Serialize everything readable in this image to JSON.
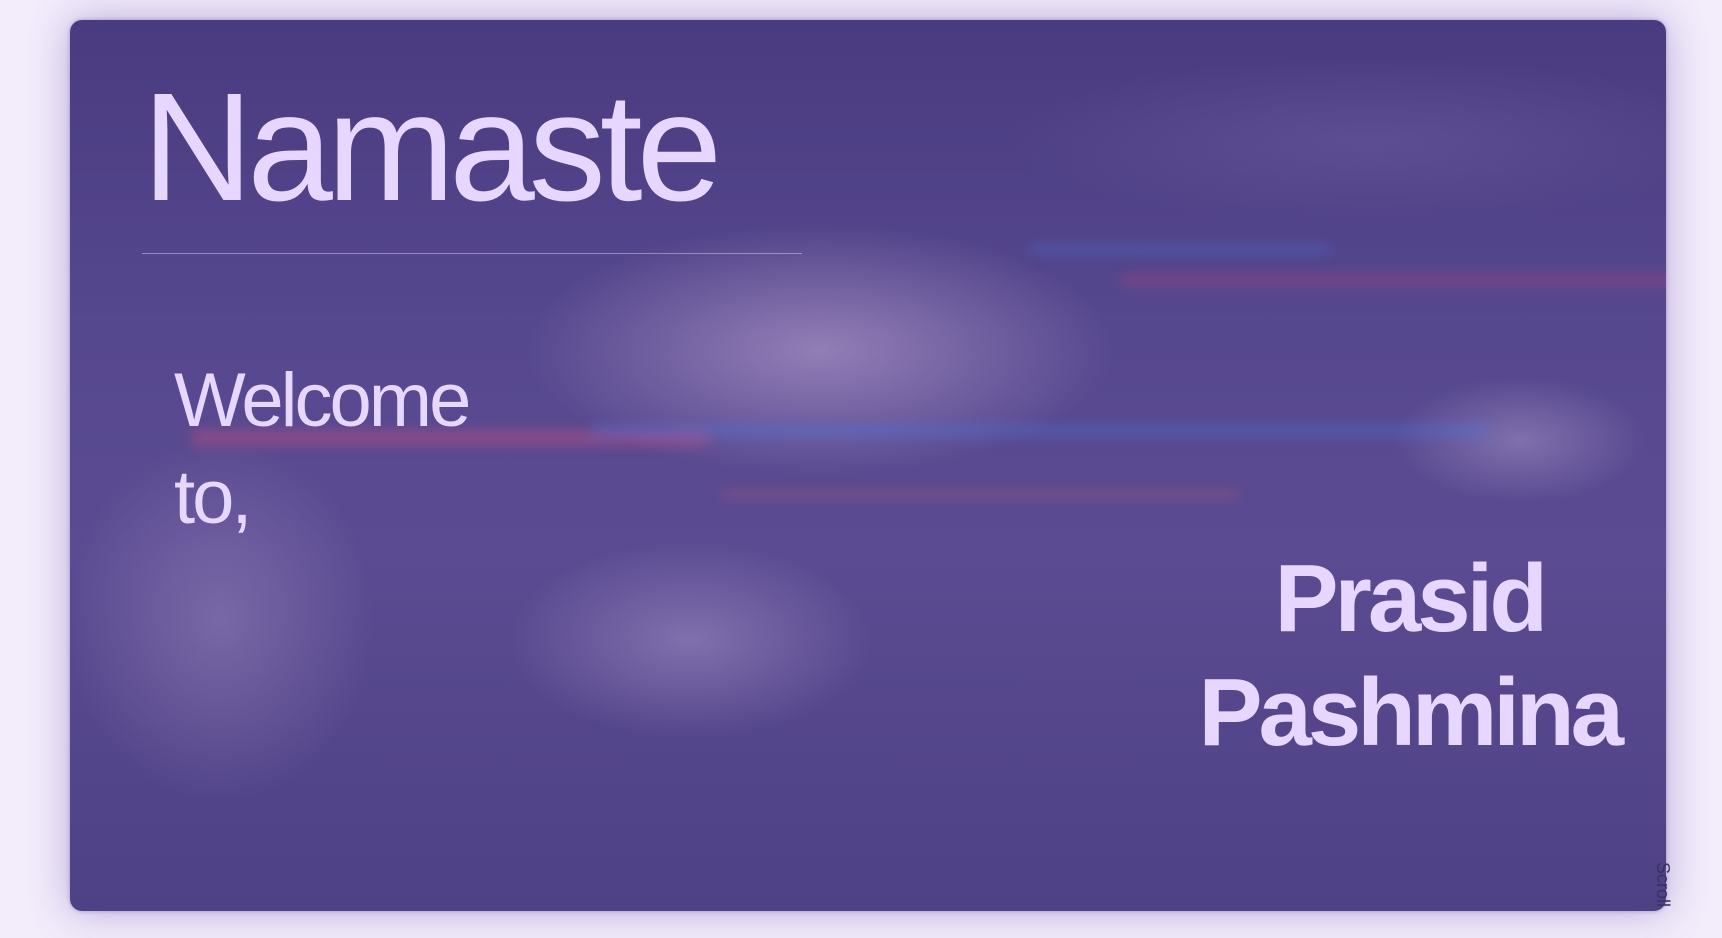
{
  "hero": {
    "title": "Namaste",
    "welcome_line_1": "Welcome",
    "welcome_line_2": "to,",
    "brand_line_1": "Prasid",
    "brand_line_2": "Pashmina"
  },
  "scroll": {
    "label": "Scroll"
  },
  "colors": {
    "page_background": "#f2ecfb",
    "overlay": "#4f4287",
    "text": "#e7d6ff"
  }
}
